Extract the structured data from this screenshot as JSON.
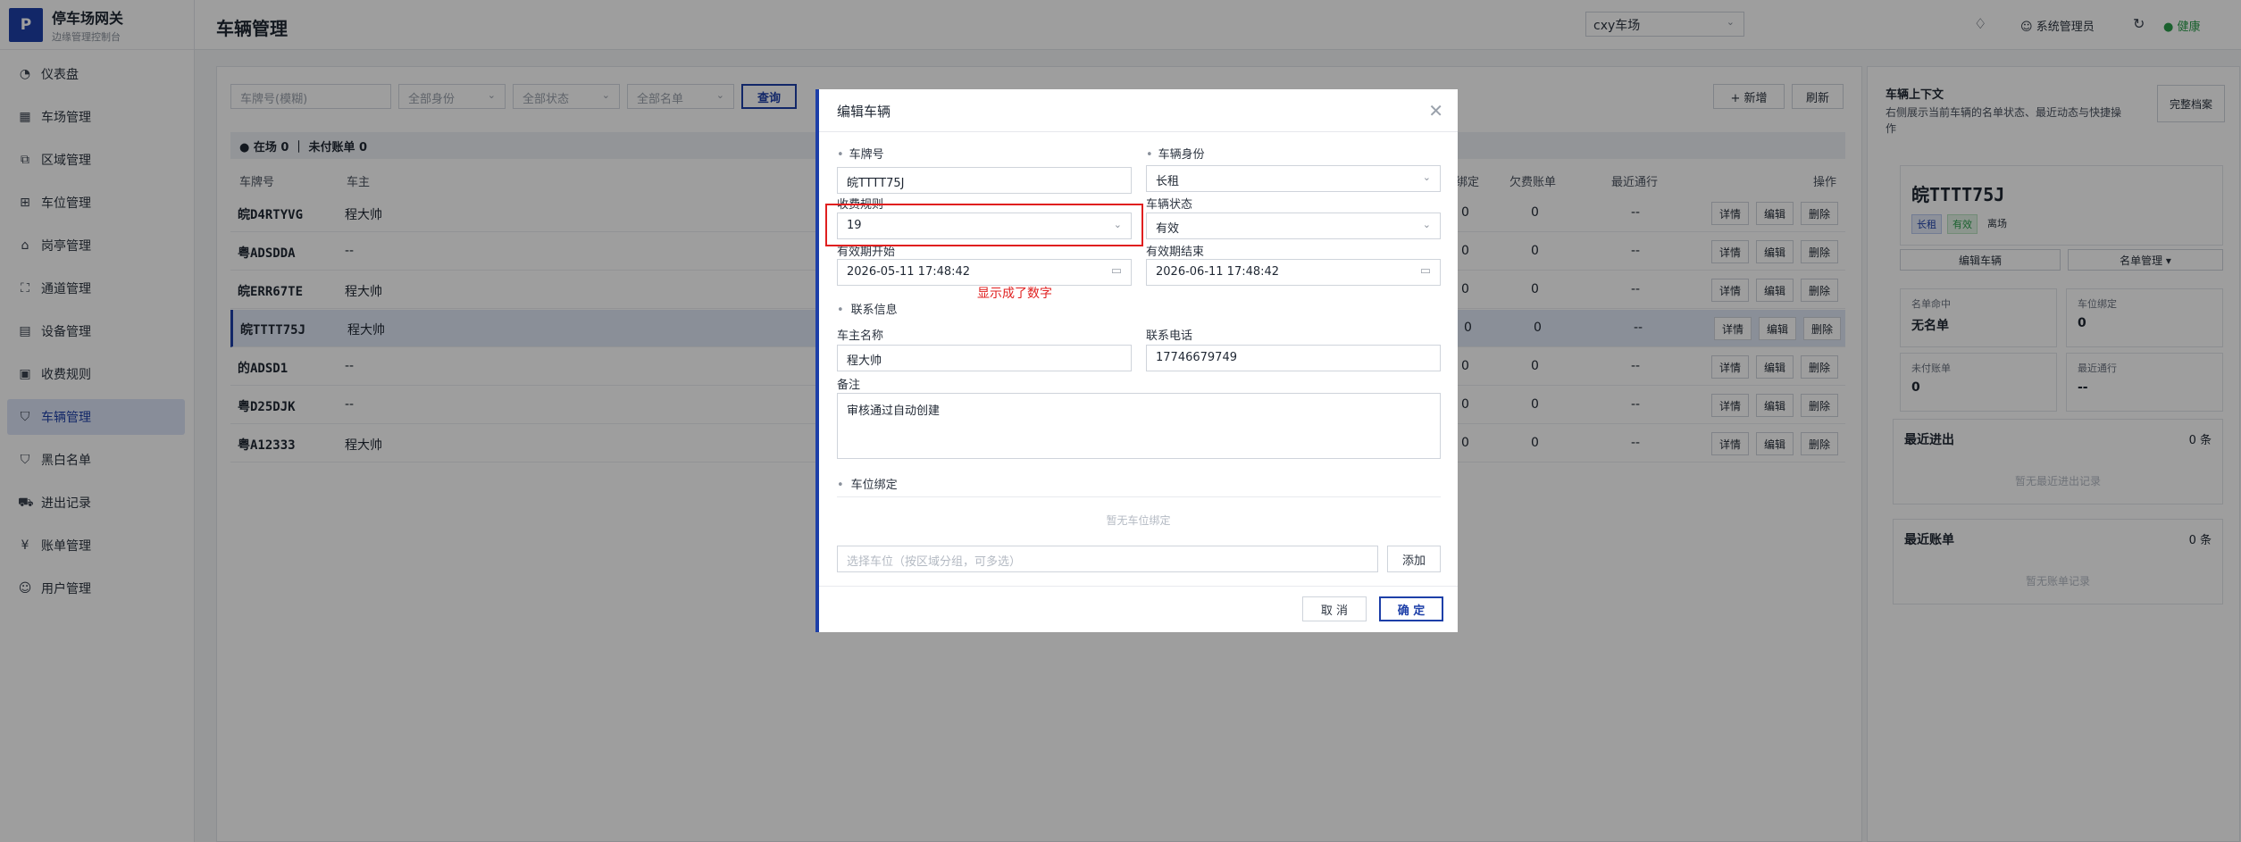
{
  "brand": {
    "logo": "P",
    "title": "停车场网关",
    "subtitle": "边缘管理控制台"
  },
  "sidebar": {
    "items": [
      {
        "label": "仪表盘",
        "icon": "dashboard-icon"
      },
      {
        "label": "车场管理",
        "icon": "grid-icon"
      },
      {
        "label": "区域管理",
        "icon": "layers-icon"
      },
      {
        "label": "车位管理",
        "icon": "table-icon"
      },
      {
        "label": "岗亭管理",
        "icon": "building-icon"
      },
      {
        "label": "通道管理",
        "icon": "gate-icon"
      },
      {
        "label": "设备管理",
        "icon": "device-icon"
      },
      {
        "label": "收费规则",
        "icon": "receipt-icon"
      },
      {
        "label": "车辆管理",
        "icon": "shield-icon",
        "active": true
      },
      {
        "label": "黑白名单",
        "icon": "shield-check-icon"
      },
      {
        "label": "进出记录",
        "icon": "car-icon"
      },
      {
        "label": "账单管理",
        "icon": "yuan-icon"
      },
      {
        "label": "用户管理",
        "icon": "user-icon"
      }
    ]
  },
  "header": {
    "title": "车辆管理",
    "lot": "cxy车场",
    "user": "系统管理员",
    "health": "健康"
  },
  "filters": {
    "plate_placeholder": "车牌号(模糊)",
    "identity": "全部身份",
    "status": "全部状态",
    "list": "全部名单",
    "query": "查询",
    "add": "+ 新增",
    "refresh": "刷新"
  },
  "stats": {
    "text": "● 在场 0 ｜ 未付账单 0"
  },
  "table": {
    "headers": [
      "车牌号",
      "车主",
      "绑定",
      "欠费账单",
      "最近通行",
      "操作"
    ],
    "actions": [
      "详情",
      "编辑",
      "删除"
    ],
    "rows": [
      {
        "plate": "皖D4RTYVG",
        "owner": "程大帅",
        "bind": "0",
        "bills": "0",
        "recent": "--"
      },
      {
        "plate": "粤ADSDDA",
        "owner": "--",
        "bind": "0",
        "bills": "0",
        "recent": "--"
      },
      {
        "plate": "皖ERR67TE",
        "owner": "程大帅",
        "bind": "0",
        "bills": "0",
        "recent": "--"
      },
      {
        "plate": "皖TTTT75J",
        "owner": "程大帅",
        "bind": "0",
        "bills": "0",
        "recent": "--"
      },
      {
        "plate": "的ADSD1",
        "owner": "--",
        "bind": "0",
        "bills": "0",
        "recent": "--"
      },
      {
        "plate": "粤D25DJK",
        "owner": "--",
        "bind": "0",
        "bills": "0",
        "recent": "--"
      },
      {
        "plate": "粤A12333",
        "owner": "程大帅",
        "bind": "0",
        "bills": "0",
        "recent": "--"
      }
    ]
  },
  "context": {
    "title": "车辆上下文",
    "desc": "右侧展示当前车辆的名单状态、最近动态与快捷操作",
    "full_btn": "完整档案",
    "plate": "皖TTTT75J",
    "tags": [
      "长租",
      "有效",
      "离场"
    ],
    "edit_btn": "编辑车辆",
    "list_btn": "名单管理 ▾",
    "stats": [
      {
        "label": "名单命中",
        "value": "无名单"
      },
      {
        "label": "车位绑定",
        "value": "0"
      },
      {
        "label": "未付账单",
        "value": "0"
      },
      {
        "label": "最近通行",
        "value": "--"
      }
    ],
    "recent_io": {
      "title": "最近进出",
      "count": "0 条",
      "empty": "暂无最近进出记录"
    },
    "recent_bills": {
      "title": "最近账单",
      "count": "0 条",
      "empty": "暂无账单记录"
    }
  },
  "modal": {
    "title": "编辑车辆",
    "plate_label": "车牌号",
    "plate_value": "皖TTTT75J",
    "identity_label": "车辆身份",
    "identity_value": "长租",
    "rule_label": "收费规则",
    "rule_value": "19",
    "status_label": "车辆状态",
    "status_value": "有效",
    "start_label": "有效期开始",
    "start_value": "2026-05-11 17:48:42",
    "end_label": "有效期结束",
    "end_value": "2026-06-11 17:48:42",
    "contact_section": "联系信息",
    "owner_label": "车主名称",
    "owner_value": "程大帅",
    "phone_label": "联系电话",
    "phone_value": "17746679749",
    "remark_label": "备注",
    "remark_value": "审核通过自动创建",
    "binding_section": "车位绑定",
    "binding_empty": "暂无车位绑定",
    "slot_placeholder": "选择车位（按区域分组，可多选）",
    "add_btn": "添加",
    "cancel": "取 消",
    "confirm": "确 定"
  },
  "annotation": {
    "text": "显示成了数字",
    "color": "#e01f1f"
  },
  "colors": {
    "accent": "#1d3fa8",
    "success": "#2a9d4b",
    "annotation": "#e01f1f"
  }
}
